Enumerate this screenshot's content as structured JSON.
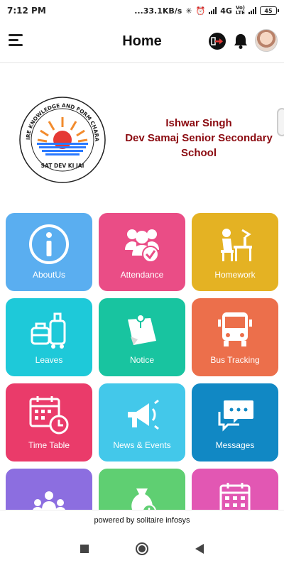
{
  "status_bar": {
    "time": "7:12 PM",
    "speed": "...33.1KB/s",
    "network": "4G",
    "volte_top": "Vo)",
    "volte_bottom": "LTE",
    "battery": "45"
  },
  "header": {
    "title": "Home"
  },
  "school": {
    "name_line1": "Ishwar Singh",
    "name_line2": "Dev Samaj Senior Secondary",
    "name_line3": "School",
    "logo_text_top": "ACQUIRE KNOWLEDGE AND FORM CHARACTER",
    "logo_text_bottom": "SAT DEV KI JAI"
  },
  "tiles": [
    {
      "label": "AboutUs",
      "color": "#5aaef0",
      "icon": "info-icon"
    },
    {
      "label": "Attendance",
      "color": "#ea4d86",
      "icon": "attendance-group-icon"
    },
    {
      "label": "Homework",
      "color": "#e4b223",
      "icon": "student-desk-icon"
    },
    {
      "label": "Leaves",
      "color": "#1ec9d9",
      "icon": "luggage-icon"
    },
    {
      "label": "Notice",
      "color": "#18c4a0",
      "icon": "pinned-note-icon"
    },
    {
      "label": "Bus Tracking",
      "color": "#ec6f4b",
      "icon": "bus-icon"
    },
    {
      "label": "Time Table",
      "color": "#ea3b6a",
      "icon": "calendar-clock-icon"
    },
    {
      "label": "News & Events",
      "color": "#43c8ea",
      "icon": "megaphone-icon"
    },
    {
      "label": "Messages",
      "color": "#1188c4",
      "icon": "chat-bubbles-icon"
    },
    {
      "label": "",
      "color": "#8c6ee0",
      "icon": "people-icon"
    },
    {
      "label": "",
      "color": "#5fcf72",
      "icon": "money-bag-icon"
    },
    {
      "label": "",
      "color": "#e257b3",
      "icon": "calendar-icon"
    }
  ],
  "footer": {
    "powered_by": "powered by solitaire infosys"
  }
}
